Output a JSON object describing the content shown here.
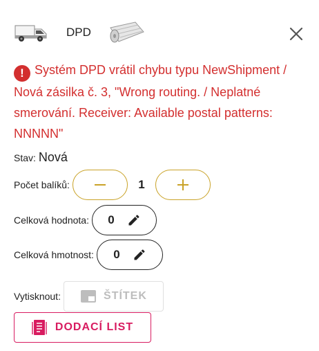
{
  "header": {
    "carrier_name": "DPD",
    "icons": [
      "van-icon",
      "roll-icon",
      "close-icon"
    ]
  },
  "error": {
    "message": "Systém DPD vrátil chybu typu NewShipment / Nová zásilka č. 3, \"Wrong routing. / Neplatné smerování. Receiver: Available postal patterns: NNNNN\"",
    "color": "#d32f2f"
  },
  "status": {
    "label": "Stav:",
    "value": "Nová"
  },
  "packages": {
    "label": "Počet balíků:",
    "value": "1"
  },
  "total_value": {
    "label": "Celková hodnota:",
    "value": "0"
  },
  "total_weight": {
    "label": "Celková hmotnost:",
    "value": "0"
  },
  "print": {
    "label": "Vytisknout:",
    "label_button": "ŠTÍTEK"
  },
  "delivery_note": {
    "label": "DODACÍ LIST",
    "color": "#d81b60"
  },
  "colors": {
    "accent_gold": "#c9a227",
    "error": "#d32f2f",
    "pink": "#d81b60"
  }
}
